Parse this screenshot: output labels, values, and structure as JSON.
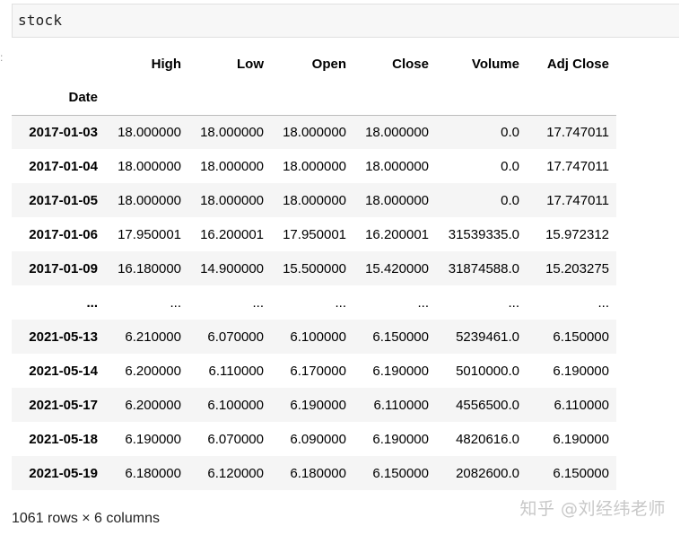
{
  "cell": {
    "code": "stock"
  },
  "table": {
    "columns": [
      "High",
      "Low",
      "Open",
      "Close",
      "Volume",
      "Adj Close"
    ],
    "index_name": "Date",
    "rows": [
      {
        "index": "2017-01-03",
        "values": [
          "18.000000",
          "18.000000",
          "18.000000",
          "18.000000",
          "0.0",
          "17.747011"
        ]
      },
      {
        "index": "2017-01-04",
        "values": [
          "18.000000",
          "18.000000",
          "18.000000",
          "18.000000",
          "0.0",
          "17.747011"
        ]
      },
      {
        "index": "2017-01-05",
        "values": [
          "18.000000",
          "18.000000",
          "18.000000",
          "18.000000",
          "0.0",
          "17.747011"
        ]
      },
      {
        "index": "2017-01-06",
        "values": [
          "17.950001",
          "16.200001",
          "17.950001",
          "16.200001",
          "31539335.0",
          "15.972312"
        ]
      },
      {
        "index": "2017-01-09",
        "values": [
          "16.180000",
          "14.900000",
          "15.500000",
          "15.420000",
          "31874588.0",
          "15.203275"
        ]
      },
      {
        "index": "...",
        "values": [
          "...",
          "...",
          "...",
          "...",
          "...",
          "..."
        ]
      },
      {
        "index": "2021-05-13",
        "values": [
          "6.210000",
          "6.070000",
          "6.100000",
          "6.150000",
          "5239461.0",
          "6.150000"
        ]
      },
      {
        "index": "2021-05-14",
        "values": [
          "6.200000",
          "6.110000",
          "6.170000",
          "6.190000",
          "5010000.0",
          "6.190000"
        ]
      },
      {
        "index": "2021-05-17",
        "values": [
          "6.200000",
          "6.100000",
          "6.190000",
          "6.110000",
          "4556500.0",
          "6.110000"
        ]
      },
      {
        "index": "2021-05-18",
        "values": [
          "6.190000",
          "6.070000",
          "6.090000",
          "6.190000",
          "4820616.0",
          "6.190000"
        ]
      },
      {
        "index": "2021-05-19",
        "values": [
          "6.180000",
          "6.120000",
          "6.180000",
          "6.150000",
          "2082600.0",
          "6.150000"
        ]
      }
    ]
  },
  "footer": {
    "shape": "1061 rows × 6 columns"
  },
  "watermark": {
    "text": "知乎 @刘经纬老师"
  }
}
